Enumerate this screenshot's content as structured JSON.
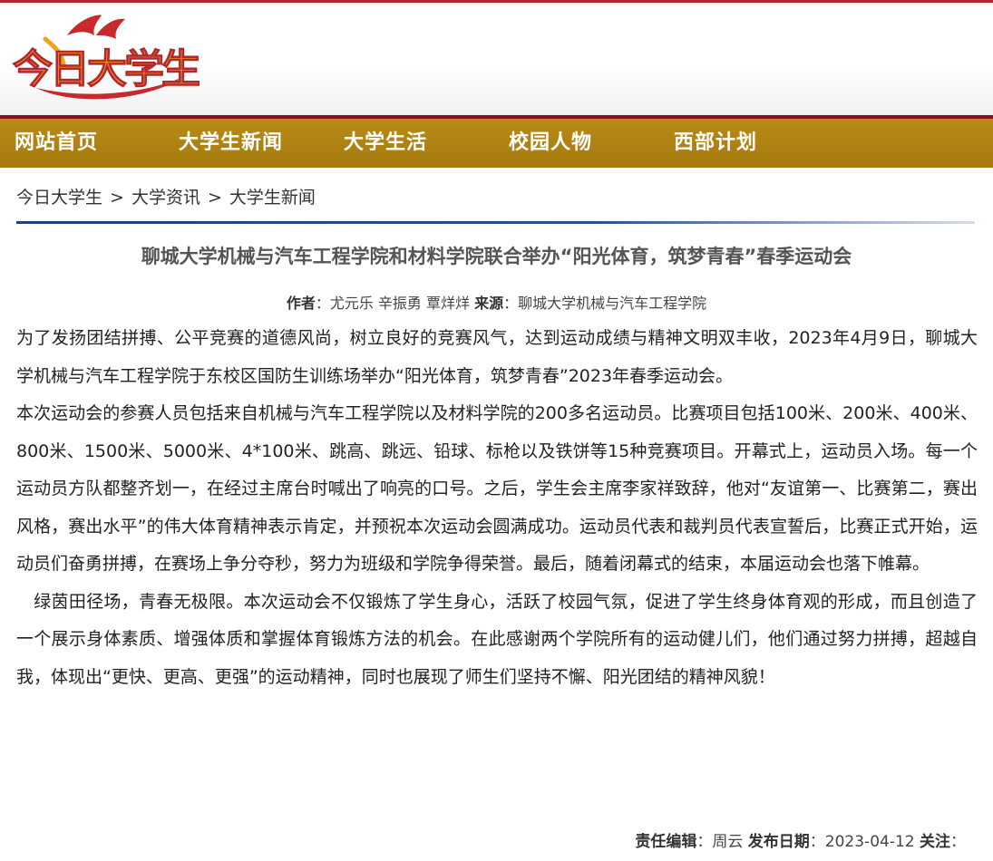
{
  "header": {
    "logo_text": "今日大学生",
    "colors": {
      "brand_red": "#b3282d",
      "brand_orange": "#f3a21b",
      "nav_gold": "#a67a10"
    }
  },
  "nav": {
    "items": [
      {
        "label": "网站首页"
      },
      {
        "label": "大学生新闻"
      },
      {
        "label": "大学生活"
      },
      {
        "label": "校园人物"
      },
      {
        "label": "西部计划"
      }
    ]
  },
  "breadcrumb": {
    "items": [
      "今日大学生",
      "大学资讯",
      "大学生新闻"
    ],
    "separator": ">"
  },
  "article": {
    "title": "聊城大学机械与汽车工程学院和材料学院联合举办“阳光体育，筑梦青春”春季运动会",
    "author_label": "作者",
    "authors": "尤元乐 辛振勇 覃烊烊",
    "source_label": "来源",
    "source": "聊城大学机械与汽车工程学院",
    "paragraphs": [
      "为了发扬团结拼搏、公平竞赛的道德风尚，树立良好的竞赛风气，达到运动成绩与精神文明双丰收，2023年4月9日，聊城大学机械与汽车工程学院于东校区国防生训练场举办“阳光体育，筑梦青春”2023年春季运动会。",
      "本次运动会的参赛人员包括来自机械与汽车工程学院以及材料学院的200多名运动员。比赛项目包括100米、200米、400米、800米、1500米、5000米、4*100米、跳高、跳远、铅球、标枪以及铁饼等15种竞赛项目。开幕式上，运动员入场。每一个运动员方队都整齐划一，在经过主席台时喊出了响亮的口号。之后，学生会主席李家祥致辞，他对“友谊第一、比赛第二，赛出风格，赛出水平”的伟大体育精神表示肯定，并预祝本次运动会圆满成功。运动员代表和裁判员代表宣誓后，比赛正式开始，运动员们奋勇拼搏，在赛场上争分夺秒，努力为班级和学院争得荣誉。最后，随着闭幕式的结束，本届运动会也落下帷幕。",
      "　绿茵田径场，青春无极限。本次运动会不仅锻炼了学生身心，活跃了校园气氛，促进了学生终身体育观的形成，而且创造了一个展示身体素质、增强体质和掌握体育锻炼方法的机会。在此感谢两个学院所有的运动健儿们，他们通过努力拼搏，超越自我，体现出“更快、更高、更强”的运动精神，同时也展现了师生们坚持不懈、阳光团结的精神风貌！"
    ],
    "editor_label": "责任编辑",
    "editor": "周云",
    "date_label": "发布日期",
    "date": "2023-04-12",
    "follow_label": "关注"
  }
}
